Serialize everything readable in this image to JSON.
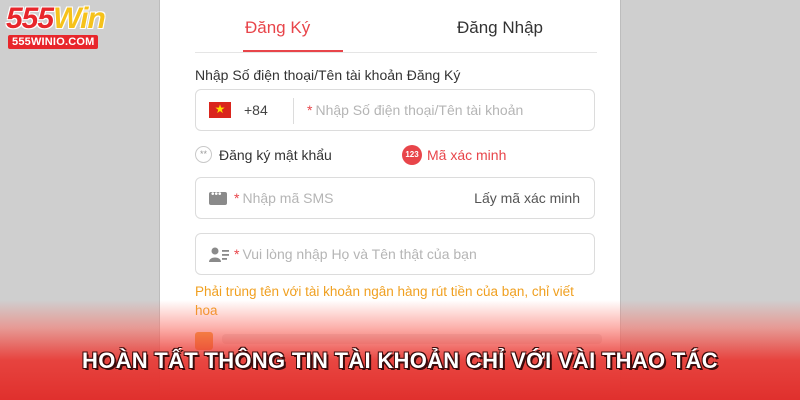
{
  "logo": {
    "main_prefix": "555",
    "main_suffix": "Win",
    "sub": "555WINIO.COM"
  },
  "tabs": {
    "register": "Đăng Ký",
    "login": "Đăng Nhập"
  },
  "form": {
    "phone_label": "Nhập Số điện thoại/Tên tài khoản Đăng Ký",
    "country_code": "+84",
    "required_mark": "*",
    "phone_placeholder": "Nhập Số điện thoại/Tên tài khoản",
    "option_password": "Đăng ký mật khẩu",
    "option_code_badge": "123",
    "option_code": "Mã xác minh",
    "sms_placeholder": "Nhập mã SMS",
    "get_code": "Lấy mã xác minh",
    "name_placeholder": "Vui lòng nhập Họ và Tên thật của bạn",
    "name_hint": "Phải trùng tên với tài khoản ngân hàng rút tiền của bạn, chỉ viết hoa"
  },
  "banner": {
    "text": "HOÀN TẤT THÔNG TIN TÀI KHOẢN CHỈ VỚI VÀI THAO TÁC"
  },
  "colors": {
    "accent": "#e8454a",
    "hint": "#f0a020",
    "flag": "#da251d"
  },
  "icons": {
    "flag": "vietnam-flag-icon",
    "sms": "sms-icon",
    "user": "user-card-icon",
    "password": "password-dots-icon",
    "code": "number-badge-icon"
  }
}
